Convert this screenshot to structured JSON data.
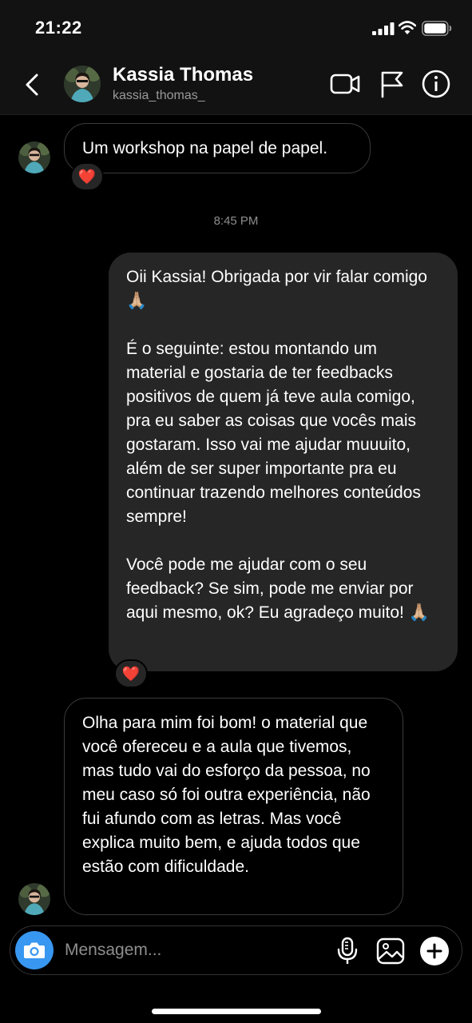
{
  "status_bar": {
    "time": "21:22",
    "icons": [
      "cellular-signal-icon",
      "wifi-icon",
      "battery-icon"
    ]
  },
  "header": {
    "back_icon": "chevron-left-icon",
    "name": "Kassia Thomas",
    "username": "kassia_thomas_",
    "actions": [
      "video-camera-icon",
      "flag-icon",
      "info-icon"
    ]
  },
  "conversation": {
    "message_1": {
      "direction": "incoming",
      "text": "Um workshop na papel de papel.",
      "reaction": "❤️"
    },
    "timestamp": "8:45 PM",
    "message_2": {
      "direction": "outgoing",
      "paragraphs": [
        "Oii Kassia! Obrigada por vir falar comigo 🙏🏼",
        "É o seguinte: estou montando um material e gostaria de ter feedbacks positivos de quem já teve aula comigo, pra eu saber as coisas que vocês mais gostaram. Isso vai me ajudar muuuito, além de ser super importante pra eu continuar trazendo melhores conteúdos sempre!",
        "Você pode me ajudar com o seu feedback? Se sim, pode me enviar por aqui mesmo, ok? Eu agradeço muito! 🙏🏼"
      ],
      "reaction": "❤️"
    },
    "message_3": {
      "direction": "incoming",
      "text": "Olha para mim foi bom! o material que você ofereceu e a aula que tivemos, mas tudo vai do esforço da pessoa, no meu caso só foi outra experiência, não fui afundo com as letras. Mas você explica muito bem, e ajuda todos que estão com dificuldade."
    }
  },
  "composer": {
    "placeholder": "Mensagem...",
    "icons": [
      "camera-icon",
      "microphone-icon",
      "gallery-icon",
      "plus-icon"
    ]
  },
  "colors": {
    "background": "#000000",
    "bar_background": "#121212",
    "outgoing_bubble": "#262626",
    "incoming_border": "#3a3a3a",
    "camera_button": "#3897f0",
    "secondary_text": "#8e8e8e"
  }
}
